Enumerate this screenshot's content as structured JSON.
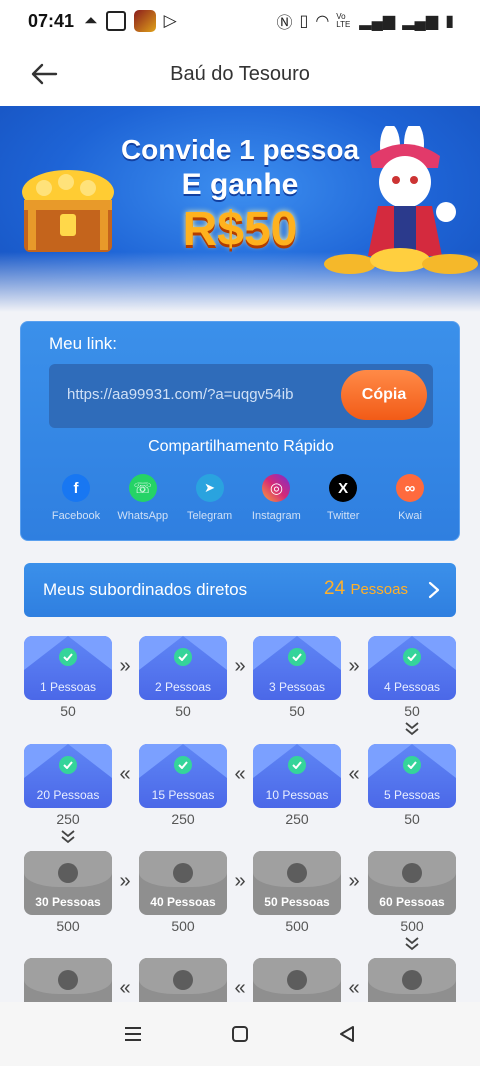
{
  "status_bar": {
    "time": "07:41",
    "network_label": "Vo LTE"
  },
  "header": {
    "title": "Baú do Tesouro"
  },
  "banner": {
    "line1": "Convide 1 pessoa",
    "line2": "E ganhe",
    "line3": "R$50"
  },
  "link_card": {
    "label": "Meu link:",
    "url": "https://aa99931.com/?a=uqgv54ib",
    "copy_label": "Cópia",
    "share_title": "Compartilhamento Rápido",
    "share": [
      {
        "name": "Facebook",
        "icon": "facebook-icon",
        "color": "#1877f2",
        "glyph": "f"
      },
      {
        "name": "WhatsApp",
        "icon": "whatsapp-icon",
        "color": "#25d366",
        "glyph": "☏"
      },
      {
        "name": "Telegram",
        "icon": "telegram-icon",
        "color": "#2aa3df",
        "glyph": "➤"
      },
      {
        "name": "Instagram",
        "icon": "instagram-icon",
        "color": "#d62976",
        "glyph": "◎"
      },
      {
        "name": "Twitter",
        "icon": "x-icon",
        "color": "#000000",
        "glyph": "X"
      },
      {
        "name": "Kwai",
        "icon": "kwai-icon",
        "color": "#ff6a3d",
        "glyph": "∞"
      }
    ]
  },
  "subordinates": {
    "label": "Meus subordinados diretos",
    "count": "24",
    "unit": "Pessoas"
  },
  "rewards": {
    "row1": [
      {
        "label": "1 Pessoas",
        "value": "50",
        "status": "done"
      },
      {
        "label": "2 Pessoas",
        "value": "50",
        "status": "done"
      },
      {
        "label": "3 Pessoas",
        "value": "50",
        "status": "done"
      },
      {
        "label": "4 Pessoas",
        "value": "50",
        "status": "done"
      }
    ],
    "row2": [
      {
        "label": "20 Pessoas",
        "value": "250",
        "status": "done"
      },
      {
        "label": "15 Pessoas",
        "value": "250",
        "status": "done"
      },
      {
        "label": "10 Pessoas",
        "value": "250",
        "status": "done"
      },
      {
        "label": "5 Pessoas",
        "value": "50",
        "status": "done"
      }
    ],
    "row3": [
      {
        "label": "30 Pessoas",
        "value": "500",
        "status": "locked"
      },
      {
        "label": "40 Pessoas",
        "value": "500",
        "status": "locked"
      },
      {
        "label": "50 Pessoas",
        "value": "500",
        "status": "locked"
      },
      {
        "label": "60 Pessoas",
        "value": "500",
        "status": "locked"
      }
    ],
    "row4": [
      {
        "label": "",
        "value": "",
        "status": "locked"
      },
      {
        "label": "",
        "value": "",
        "status": "locked"
      },
      {
        "label": "",
        "value": "",
        "status": "locked"
      },
      {
        "label": "",
        "value": "",
        "status": "locked"
      }
    ]
  },
  "colors": {
    "accent_blue": "#2f7fe0",
    "copy_orange": "#f25b17",
    "count_orange": "#ffb02a",
    "check_green": "#35d49a"
  }
}
